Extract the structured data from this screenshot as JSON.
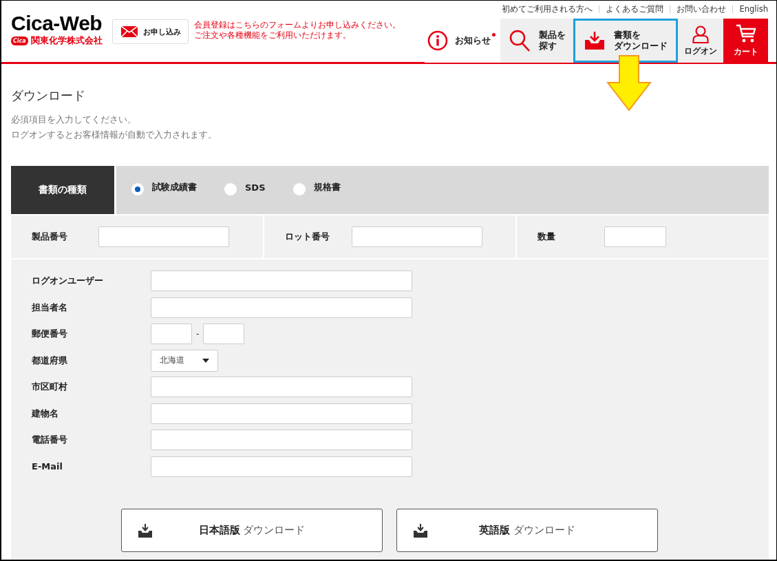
{
  "header": {
    "logo": {
      "title": "Cica-Web",
      "mark": "Cica",
      "company": "関東化学株式会社"
    },
    "apply_button": {
      "label": "お申し込み"
    },
    "apply_note": [
      "会員登録はこちらのフォームよりお申し込みください。",
      "ご注文や各種機能をご利用いただけます。"
    ],
    "top_links": [
      "初めてご利用される方へ",
      "よくあるご質問",
      "お問い合わせ",
      "English"
    ],
    "nav": [
      {
        "kind": "notice",
        "label": [
          "お知らせ"
        ],
        "unread": true,
        "highlighted": false
      },
      {
        "kind": "search",
        "label": [
          "製品を",
          "探す"
        ],
        "highlighted": false
      },
      {
        "kind": "download",
        "label": [
          "書類を",
          "ダウンロード"
        ],
        "highlighted": true
      },
      {
        "kind": "login",
        "label": [
          "ログオン"
        ],
        "highlighted": false
      },
      {
        "kind": "cart",
        "label": [
          "カート"
        ],
        "highlighted": false
      }
    ],
    "annotation_arrow": true
  },
  "page": {
    "title": "ダウンロード",
    "intro": [
      "必須項目を入力してください。",
      "ログオンするとお客様情報が自動で入力されます。"
    ]
  },
  "doc_type": {
    "label": "書類の種類",
    "options": [
      {
        "label": "試験成績書",
        "selected": true
      },
      {
        "label": "SDS",
        "selected": false
      },
      {
        "label": "規格書",
        "selected": false
      }
    ]
  },
  "product_fields": [
    {
      "label": "製品番号",
      "kind": "wide"
    },
    {
      "label": "ロット番号",
      "kind": "wide"
    },
    {
      "label": "数量",
      "kind": "short"
    }
  ],
  "contact_fields": [
    {
      "label": "ログオンユーザー",
      "kind": "text"
    },
    {
      "label": "担当者名",
      "kind": "text"
    },
    {
      "label": "郵便番号",
      "kind": "postal",
      "separator": "-"
    },
    {
      "label": "都道府県",
      "kind": "select",
      "value": "北海道"
    },
    {
      "label": "市区町村",
      "kind": "text"
    },
    {
      "label": "建物名",
      "kind": "text"
    },
    {
      "label": "電話番号",
      "kind": "text"
    },
    {
      "label": "E-Mail",
      "kind": "text"
    }
  ],
  "download_buttons": [
    "**日本語版** ダウンロード",
    "**英語版** ダウンロード"
  ]
}
